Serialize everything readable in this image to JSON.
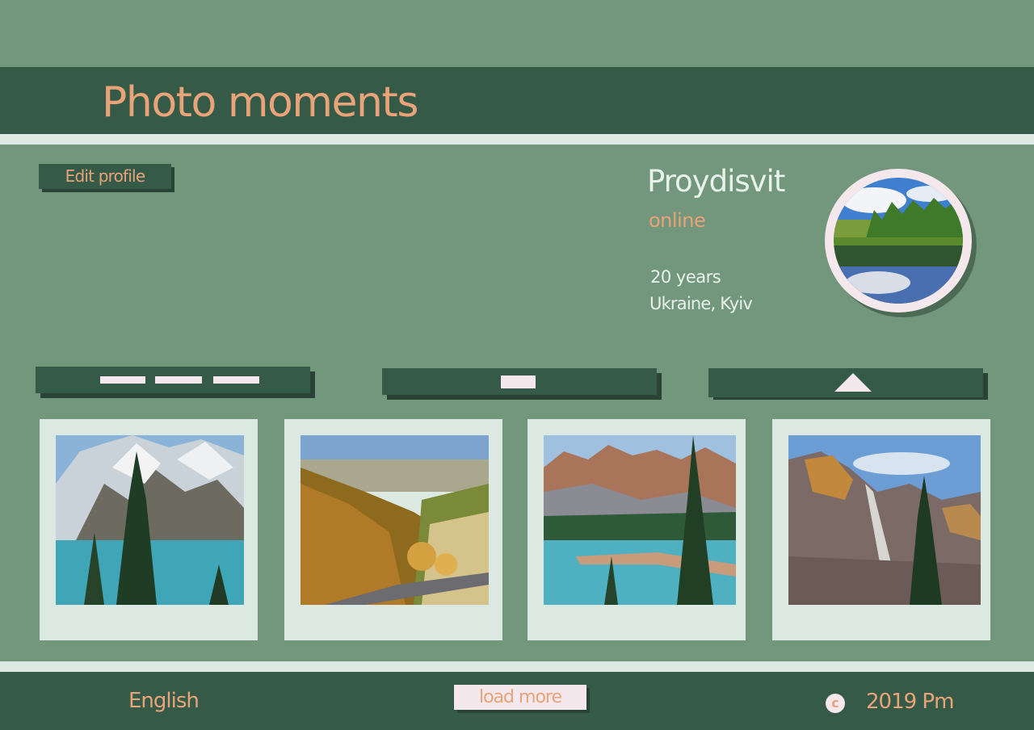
{
  "header": {
    "title": "Photo moments"
  },
  "profile": {
    "edit_label": "Edit profile",
    "username": "Proydisvit",
    "status": "online",
    "age": "20 years",
    "location": "Ukraine, Kyiv"
  },
  "toolbar": {
    "items": [
      {
        "icon": "list-view-icon"
      },
      {
        "icon": "single-view-icon"
      },
      {
        "icon": "scroll-up-icon"
      }
    ]
  },
  "photos": [
    {
      "subject": "snowy mountain lake with fir tree"
    },
    {
      "subject": "autumn forest hills with road"
    },
    {
      "subject": "rocky peaks above turquoise lake"
    },
    {
      "subject": "rocky mountain with pine tree"
    }
  ],
  "footer": {
    "language": "English",
    "load_more_label": "load more",
    "copyright_symbol": "c",
    "copyright_text": "2019 Pm"
  },
  "colors": {
    "background": "#73977c",
    "bar": "#355a47",
    "stripe": "#dce9e3",
    "accent": "#e8a378",
    "light": "#f4e8ec"
  }
}
